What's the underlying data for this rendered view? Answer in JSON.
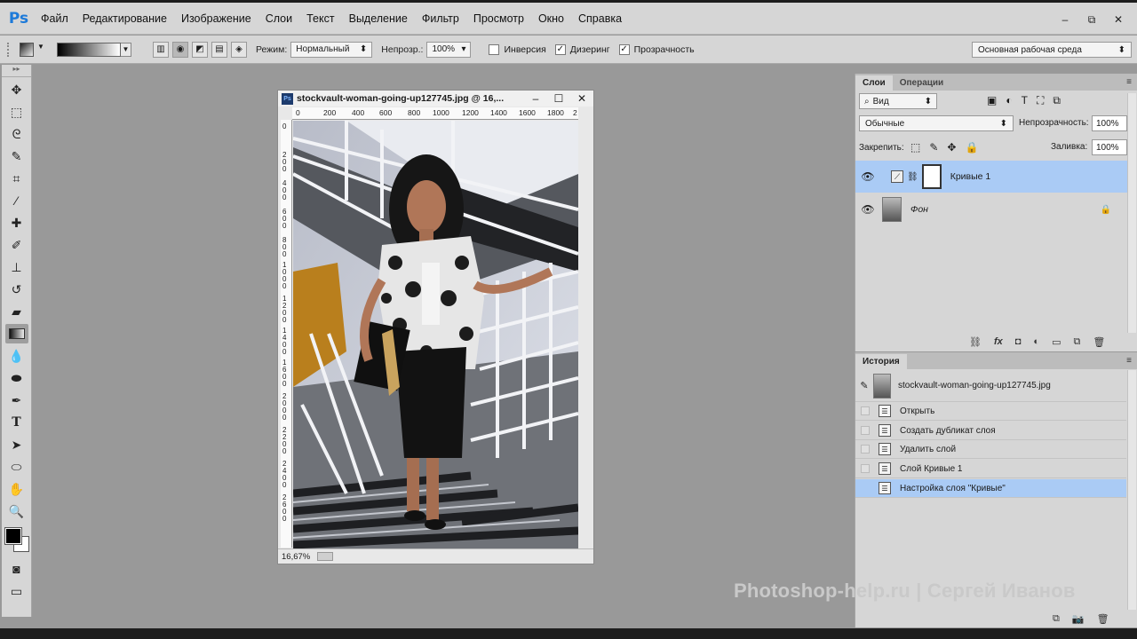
{
  "app": {
    "logo": "Ps"
  },
  "menu": [
    "Файл",
    "Редактирование",
    "Изображение",
    "Слои",
    "Текст",
    "Выделение",
    "Фильтр",
    "Просмотр",
    "Окно",
    "Справка"
  ],
  "window_controls": {
    "minimize": "–",
    "restore": "⧉",
    "close": "✕"
  },
  "options": {
    "mode_label": "Режим:",
    "mode_value": "Нормальный",
    "opacity_label": "Непрозр.:",
    "opacity_value": "100%",
    "inverse_label": "Инверсия",
    "inverse_checked": false,
    "dither_label": "Дизеринг",
    "dither_checked": true,
    "transparency_label": "Прозрачность",
    "transparency_checked": true,
    "workspace": "Основная рабочая среда"
  },
  "toolbar": {
    "tools": [
      "move-tool",
      "marquee-tool",
      "lasso-tool",
      "quick-select-tool",
      "crop-tool",
      "eyedropper-tool",
      "healing-tool",
      "brush-tool",
      "stamp-tool",
      "history-brush-tool",
      "eraser-tool",
      "gradient-tool",
      "blur-tool",
      "dodge-tool",
      "pen-tool",
      "type-tool",
      "path-select-tool",
      "shape-tool",
      "hand-tool",
      "zoom-tool"
    ],
    "active": "gradient-tool",
    "fg_color": "#000000",
    "bg_color": "#ffffff"
  },
  "document": {
    "title": "stockvault-woman-going-up127745.jpg @ 16,...",
    "zoom": "16,67%",
    "ruler_h": [
      "0",
      "200",
      "400",
      "600",
      "800",
      "1000",
      "1200",
      "1400",
      "1600",
      "1800",
      "2"
    ],
    "ruler_v": [
      "0",
      "200",
      "400",
      "600",
      "800",
      "1000",
      "1200",
      "1400",
      "1600",
      "2000",
      "2200",
      "2400",
      "2600"
    ]
  },
  "layers_panel": {
    "tab_layers": "Слои",
    "tab_actions": "Операции",
    "filter_kind": "Вид",
    "blend_mode": "Обычные",
    "opacity_label": "Непрозрачность:",
    "opacity_value": "100%",
    "lock_label": "Закрепить:",
    "fill_label": "Заливка:",
    "fill_value": "100%",
    "layers": [
      {
        "name": "Кривые 1",
        "selected": true
      },
      {
        "name": "Фон",
        "selected": false,
        "locked": true
      }
    ]
  },
  "history_panel": {
    "tab": "История",
    "snapshot": "stockvault-woman-going-up127745.jpg",
    "steps": [
      "Открыть",
      "Создать дубликат слоя",
      "Удалить слой",
      "Слой Кривые 1",
      "Настройка слоя \"Кривые\""
    ],
    "selected_index": 4
  },
  "watermark": "Photoshop-help.ru | Сергей Иванов",
  "accent": "#aacbf5"
}
